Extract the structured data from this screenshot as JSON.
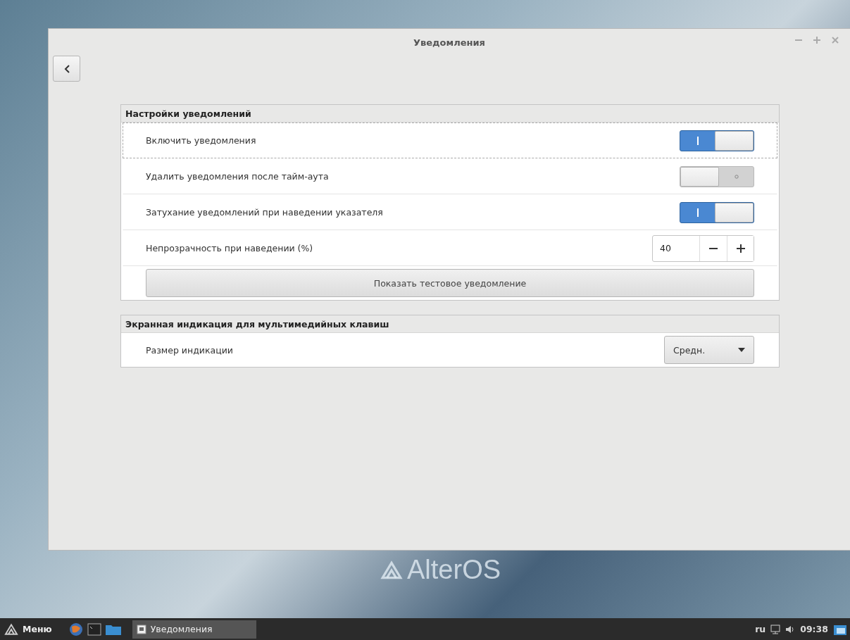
{
  "window": {
    "title": "Уведомления"
  },
  "sections": [
    {
      "title": "Настройки уведомлений",
      "rows": [
        {
          "kind": "switch",
          "label": "Включить уведомления",
          "on": true,
          "focused": true
        },
        {
          "kind": "switch",
          "label": "Удалить уведомления после  тайм-аута",
          "on": false,
          "focused": false
        },
        {
          "kind": "switch",
          "label": "Затухание уведомлений при наведении указателя",
          "on": true,
          "focused": false
        },
        {
          "kind": "spin",
          "label": "Непрозрачность при наведении (%)",
          "value": "40"
        },
        {
          "kind": "button",
          "label": "Показать тестовое уведомление"
        }
      ]
    },
    {
      "title": "Экранная индикация для мультимедийных клавиш",
      "rows": [
        {
          "kind": "dropdown",
          "label": "Размер индикации",
          "value": "Средн."
        }
      ]
    }
  ],
  "desktop": {
    "logo": "AlterOS"
  },
  "taskbar": {
    "menu": "Меню",
    "tasks": [
      "Уведомления"
    ],
    "language": "ru",
    "time": "09:38"
  }
}
